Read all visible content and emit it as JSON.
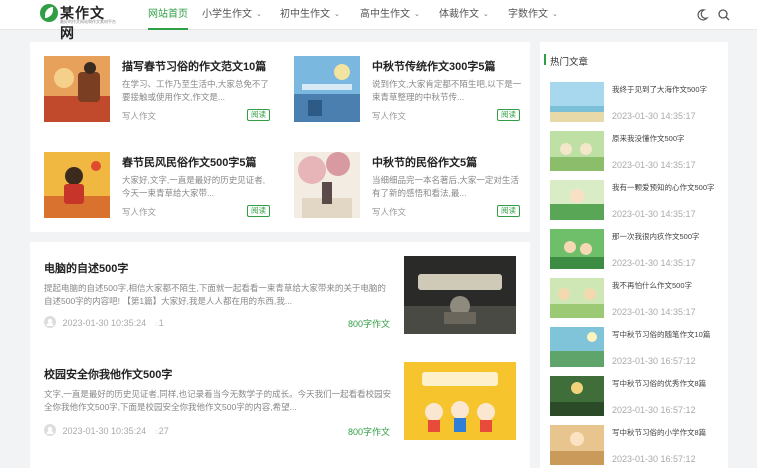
{
  "brand": {
    "title": "某作文网",
    "subtitle": "最好的作文网站和作文素材平台"
  },
  "nav": {
    "items": [
      {
        "label": "网站首页",
        "caret": ""
      },
      {
        "label": "小学生作文",
        "caret": "⌄"
      },
      {
        "label": "初中生作文",
        "caret": "⌄"
      },
      {
        "label": "高中生作文",
        "caret": "⌄"
      },
      {
        "label": "体裁作文",
        "caret": "⌄"
      },
      {
        "label": "字数作文",
        "caret": "⌄"
      }
    ]
  },
  "cards": [
    {
      "title": "描写春节习俗的作文范文10篇",
      "excerpt": "在学习、工作乃至生活中,大家总免不了要接触或使用作文,作文是...",
      "category": "写人作文",
      "badge": "阅读"
    },
    {
      "title": "中秋节传统作文300字5篇",
      "excerpt": "说到作文,大家肯定都不陌生吧,以下是一束青草整理的中秋节传...",
      "category": "写人作文",
      "badge": "阅读"
    },
    {
      "title": "春节民风民俗作文500字5篇",
      "excerpt": "大家好,文字,一直是最好的历史见证者,今天一束青草给大家带...",
      "category": "写人作文",
      "badge": "阅读"
    },
    {
      "title": "中秋节的民俗作文5篇",
      "excerpt": "当细细品完一本名著后,大家一定对生活有了新的感悟和看法,最...",
      "category": "写人作文",
      "badge": "阅读"
    }
  ],
  "posts": [
    {
      "title": "电脑的自述500字",
      "excerpt": "提起电脑的自述500字,相信大家都不陌生,下面就一起看看一束青草给大家带来的关于电脑的自述500字的内容吧! 【第1篇】大家好,我是人人都在用的东西,我...",
      "date": "2023-01-30 10:35:24",
      "comments": "1",
      "category": "800字作文"
    },
    {
      "title": "校园安全你我他作文500字",
      "excerpt": "文字,一直是最好的历史见证者,同样,也记录着当今无数学子的成长。今天我们一起看看校园安全你我他作文500字,下面是校园安全你我他作文500字的内容,希望...",
      "date": "2023-01-30 10:35:24",
      "comments": "27",
      "category": "800字作文"
    }
  ],
  "sidebar": {
    "heading": "热门文章",
    "items": [
      {
        "title": "我终于见到了大海作文500字",
        "date": "2023-01-30 14:35:17"
      },
      {
        "title": "原来我没懂作文500字",
        "date": "2023-01-30 14:35:17"
      },
      {
        "title": "我有一颗爱预知的心作文500字",
        "date": "2023-01-30 14:35:17"
      },
      {
        "title": "那一次我很内疚作文500字",
        "date": "2023-01-30 14:35:17"
      },
      {
        "title": "我不再怕什么作文500字",
        "date": "2023-01-30 14:35:17"
      },
      {
        "title": "写中秋节习俗的随笔作文10篇",
        "date": "2023-01-30 16:57:12"
      },
      {
        "title": "写中秋节习俗的优秀作文8篇",
        "date": "2023-01-30 16:57:12"
      },
      {
        "title": "写中秋节习俗的小学作文8篇",
        "date": "2023-01-30 16:57:12"
      }
    ]
  },
  "icons": {
    "theme": "moon-icon",
    "search": "search-icon",
    "comment": "comment-icon",
    "avatar": "avatar-icon"
  },
  "colors": {
    "accent": "#2f9e44",
    "background": "#f2f3f5"
  }
}
